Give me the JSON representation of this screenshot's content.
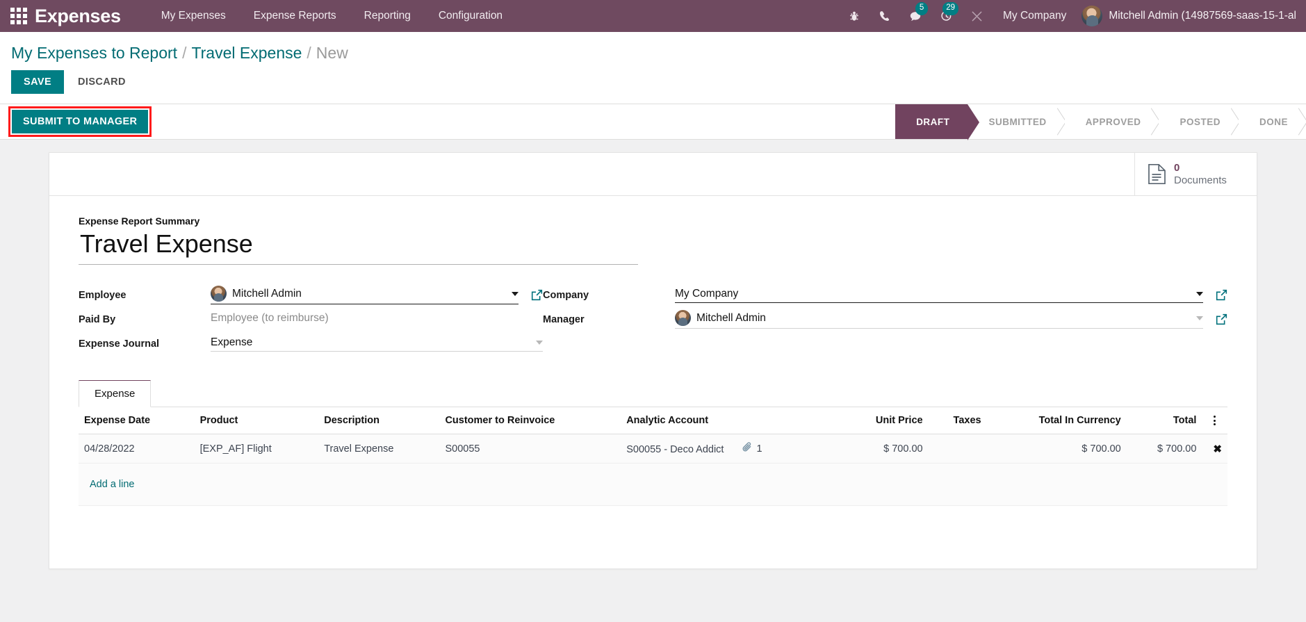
{
  "navbar": {
    "apps_icon": "apps-grid-icon",
    "brand": "Expenses",
    "menu": [
      {
        "label": "My Expenses"
      },
      {
        "label": "Expense Reports"
      },
      {
        "label": "Reporting"
      },
      {
        "label": "Configuration"
      }
    ],
    "icons": [
      {
        "name": "bug-icon",
        "badge": ""
      },
      {
        "name": "phone-icon",
        "badge": ""
      },
      {
        "name": "messages-icon",
        "badge": "5"
      },
      {
        "name": "activities-clock-icon",
        "badge": "29"
      },
      {
        "name": "tools-wrench-icon",
        "badge": ""
      }
    ],
    "company": "My Company",
    "user": "Mitchell Admin (14987569-saas-15-1-al",
    "accent_bg": "#6f4a60",
    "badge_color": "#017e84"
  },
  "breadcrumb": {
    "root": "My Expenses to Report",
    "sep": "/",
    "parent": "Travel Expense",
    "current": "New"
  },
  "control_buttons": {
    "save": "SAVE",
    "discard": "DISCARD"
  },
  "action_bar": {
    "submit": "SUBMIT TO MANAGER",
    "highlight_color": "#ff1a1a",
    "statuses": [
      {
        "label": "DRAFT",
        "active": true
      },
      {
        "label": "SUBMITTED",
        "active": false
      },
      {
        "label": "APPROVED",
        "active": false
      },
      {
        "label": "POSTED",
        "active": false
      },
      {
        "label": "DONE",
        "active": false
      }
    ]
  },
  "smart_buttons": [
    {
      "icon": "document-icon",
      "value": "0",
      "label": "Documents"
    }
  ],
  "form": {
    "summary_label": "Expense Report Summary",
    "summary_value": "Travel Expense",
    "left_fields": [
      {
        "label": "Employee",
        "value": "Mitchell Admin",
        "avatar": true,
        "caret": true,
        "external": true,
        "muted": false
      },
      {
        "label": "Paid By",
        "value": "Employee (to reimburse)",
        "avatar": false,
        "caret": false,
        "external": false,
        "muted": true
      },
      {
        "label": "Expense Journal",
        "value": "Expense",
        "avatar": false,
        "caret": true,
        "external": false,
        "muted": false
      }
    ],
    "right_fields": [
      {
        "label": "Company",
        "value": "My Company",
        "avatar": false,
        "caret": true,
        "external": true,
        "muted": false
      },
      {
        "label": "Manager",
        "value": "Mitchell Admin",
        "avatar": true,
        "caret": true,
        "external": true,
        "muted": false
      }
    ]
  },
  "notebook": {
    "tabs": [
      {
        "label": "Expense",
        "active": true
      }
    ],
    "columns": [
      "Expense Date",
      "Product",
      "Description",
      "Customer to Reinvoice",
      "Analytic Account",
      "Unit Price",
      "Taxes",
      "Total In Currency",
      "Total"
    ],
    "rows": [
      {
        "expense_date": "04/28/2022",
        "product": "[EXP_AF] Flight",
        "description": "Travel Expense",
        "customer_to_reinvoice": "S00055",
        "analytic_account": "S00055 - Deco Addict",
        "attachment_count": "1",
        "unit_price": "$ 700.00",
        "taxes": "",
        "total_in_currency": "$ 700.00",
        "total": "$ 700.00",
        "delete_glyph": "✖"
      }
    ],
    "add_line": "Add a line",
    "optional_columns_icon": "kebab-menu-icon"
  }
}
